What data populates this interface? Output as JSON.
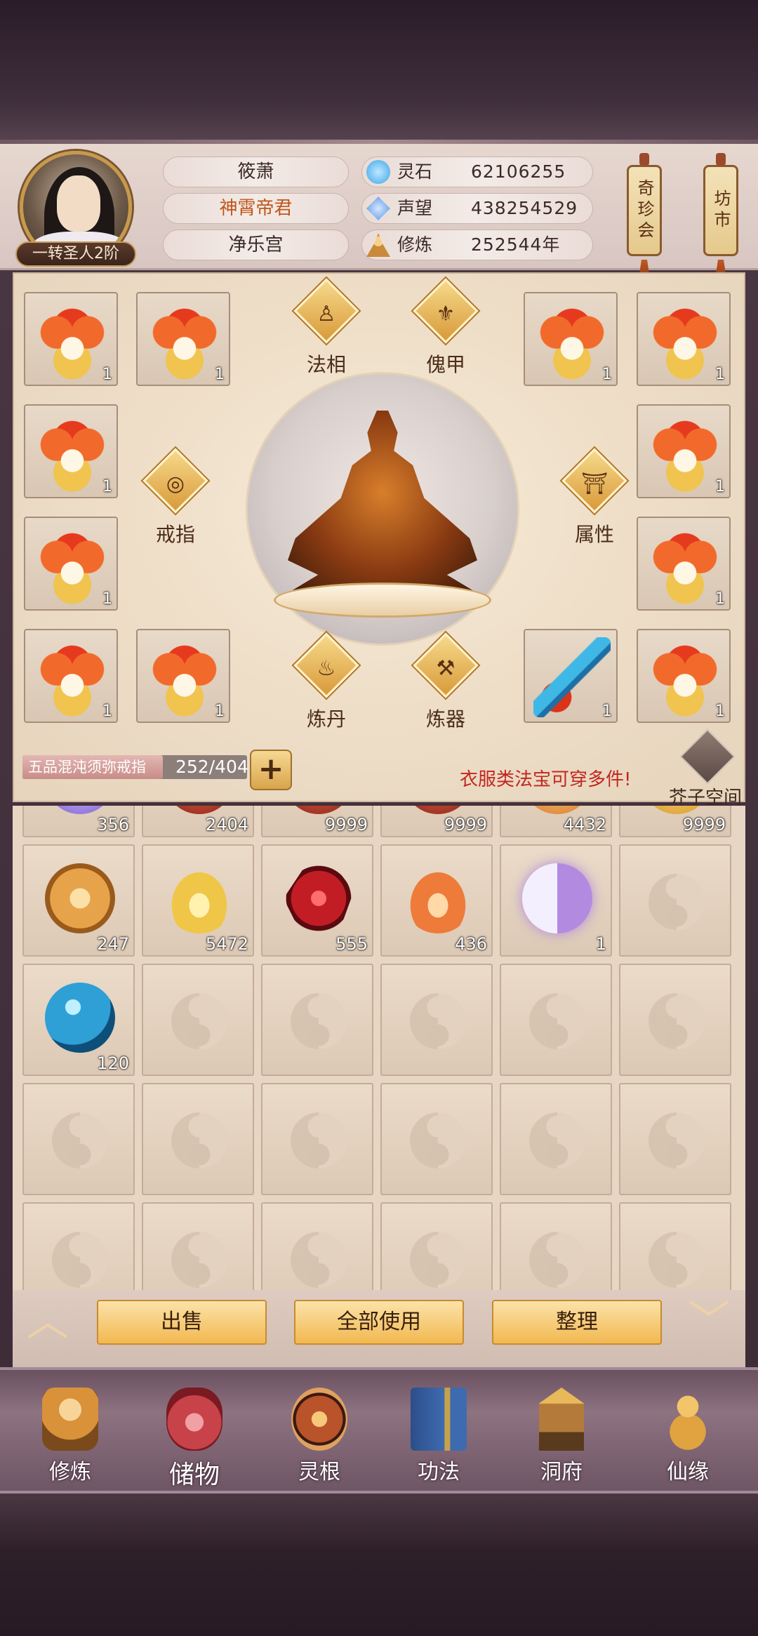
{
  "player": {
    "rank": "一转圣人2阶",
    "name": "筱萧",
    "title": "神霄帝君",
    "sect": "净乐宫"
  },
  "resources": [
    {
      "label": "灵石",
      "value": "62106255",
      "icon": "spirit-stone-icon",
      "color": "#3aa6e8"
    },
    {
      "label": "声望",
      "value": "438254529",
      "icon": "prestige-crystal-icon",
      "color": "#4a8fe0"
    },
    {
      "label": "修炼",
      "value": "252544年",
      "icon": "cultivation-icon",
      "color": "#c98a3a"
    }
  ],
  "shops": {
    "treasure": "奇珍会",
    "market": "坊市"
  },
  "equip_slots": {
    "count_text": "1"
  },
  "center_buttons": {
    "faxiang": "法相",
    "kuijia": "傀甲",
    "jiezhi": "戒指",
    "shuxing": "属性",
    "liandan": "炼丹",
    "lianqi": "炼器"
  },
  "storage": {
    "name": "五品混沌须弥戒指",
    "used": 252,
    "capacity": 404,
    "ratio": "252/404",
    "plus": "+",
    "hint": "衣服类法宝可穿多件!",
    "space_label": "芥子空间"
  },
  "inventory": {
    "row0": [
      "356",
      "2404",
      "9999",
      "9999",
      "4432",
      "9999"
    ],
    "row1": [
      {
        "count": "247",
        "icon": "golden-coil-icon",
        "color": "#e6a34a"
      },
      {
        "count": "5472",
        "icon": "golden-dragon-icon",
        "color": "#f0c648"
      },
      {
        "count": "555",
        "icon": "red-crystal-icon",
        "color": "#c21d24"
      },
      {
        "count": "436",
        "icon": "flame-dragon-icon",
        "color": "#ee7b3a"
      },
      {
        "count": "1",
        "icon": "taiji-orb-icon",
        "color": "#b28be0"
      }
    ],
    "row2": [
      {
        "count": "120",
        "icon": "blue-pearl-icon",
        "color": "#2ea0d6"
      }
    ]
  },
  "actions": {
    "sell": "出售",
    "use_all": "全部使用",
    "sort": "整理",
    "up": "︿",
    "down": "﹀"
  },
  "nav": [
    {
      "label": "修炼",
      "icon": "cultivate-monk-icon",
      "color": "#d9913a"
    },
    {
      "label": "储物",
      "icon": "storage-bag-icon",
      "color": "#c8424a"
    },
    {
      "label": "灵根",
      "icon": "spirit-root-icon",
      "color": "#b8532a"
    },
    {
      "label": "功法",
      "icon": "skill-book-icon",
      "color": "#3e6bb0"
    },
    {
      "label": "洞府",
      "icon": "cave-palace-icon",
      "color": "#b37a3a"
    },
    {
      "label": "仙缘",
      "icon": "gourd-icon",
      "color": "#e0a340"
    }
  ]
}
